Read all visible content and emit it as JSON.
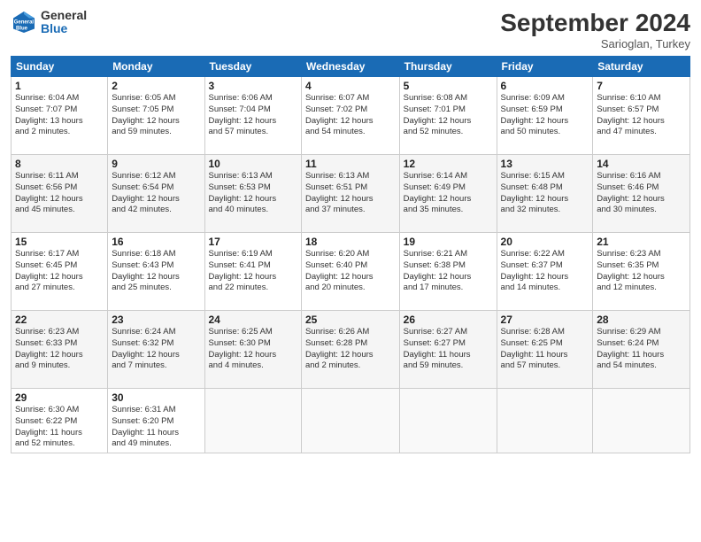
{
  "header": {
    "logo": {
      "line1": "General",
      "line2": "Blue"
    },
    "title": "September 2024",
    "subtitle": "Sarioglan, Turkey"
  },
  "weekdays": [
    "Sunday",
    "Monday",
    "Tuesday",
    "Wednesday",
    "Thursday",
    "Friday",
    "Saturday"
  ],
  "weeks": [
    [
      {
        "day": "1",
        "info": "Sunrise: 6:04 AM\nSunset: 7:07 PM\nDaylight: 13 hours\nand 2 minutes."
      },
      {
        "day": "2",
        "info": "Sunrise: 6:05 AM\nSunset: 7:05 PM\nDaylight: 12 hours\nand 59 minutes."
      },
      {
        "day": "3",
        "info": "Sunrise: 6:06 AM\nSunset: 7:04 PM\nDaylight: 12 hours\nand 57 minutes."
      },
      {
        "day": "4",
        "info": "Sunrise: 6:07 AM\nSunset: 7:02 PM\nDaylight: 12 hours\nand 54 minutes."
      },
      {
        "day": "5",
        "info": "Sunrise: 6:08 AM\nSunset: 7:01 PM\nDaylight: 12 hours\nand 52 minutes."
      },
      {
        "day": "6",
        "info": "Sunrise: 6:09 AM\nSunset: 6:59 PM\nDaylight: 12 hours\nand 50 minutes."
      },
      {
        "day": "7",
        "info": "Sunrise: 6:10 AM\nSunset: 6:57 PM\nDaylight: 12 hours\nand 47 minutes."
      }
    ],
    [
      {
        "day": "8",
        "info": "Sunrise: 6:11 AM\nSunset: 6:56 PM\nDaylight: 12 hours\nand 45 minutes."
      },
      {
        "day": "9",
        "info": "Sunrise: 6:12 AM\nSunset: 6:54 PM\nDaylight: 12 hours\nand 42 minutes."
      },
      {
        "day": "10",
        "info": "Sunrise: 6:13 AM\nSunset: 6:53 PM\nDaylight: 12 hours\nand 40 minutes."
      },
      {
        "day": "11",
        "info": "Sunrise: 6:13 AM\nSunset: 6:51 PM\nDaylight: 12 hours\nand 37 minutes."
      },
      {
        "day": "12",
        "info": "Sunrise: 6:14 AM\nSunset: 6:49 PM\nDaylight: 12 hours\nand 35 minutes."
      },
      {
        "day": "13",
        "info": "Sunrise: 6:15 AM\nSunset: 6:48 PM\nDaylight: 12 hours\nand 32 minutes."
      },
      {
        "day": "14",
        "info": "Sunrise: 6:16 AM\nSunset: 6:46 PM\nDaylight: 12 hours\nand 30 minutes."
      }
    ],
    [
      {
        "day": "15",
        "info": "Sunrise: 6:17 AM\nSunset: 6:45 PM\nDaylight: 12 hours\nand 27 minutes."
      },
      {
        "day": "16",
        "info": "Sunrise: 6:18 AM\nSunset: 6:43 PM\nDaylight: 12 hours\nand 25 minutes."
      },
      {
        "day": "17",
        "info": "Sunrise: 6:19 AM\nSunset: 6:41 PM\nDaylight: 12 hours\nand 22 minutes."
      },
      {
        "day": "18",
        "info": "Sunrise: 6:20 AM\nSunset: 6:40 PM\nDaylight: 12 hours\nand 20 minutes."
      },
      {
        "day": "19",
        "info": "Sunrise: 6:21 AM\nSunset: 6:38 PM\nDaylight: 12 hours\nand 17 minutes."
      },
      {
        "day": "20",
        "info": "Sunrise: 6:22 AM\nSunset: 6:37 PM\nDaylight: 12 hours\nand 14 minutes."
      },
      {
        "day": "21",
        "info": "Sunrise: 6:23 AM\nSunset: 6:35 PM\nDaylight: 12 hours\nand 12 minutes."
      }
    ],
    [
      {
        "day": "22",
        "info": "Sunrise: 6:23 AM\nSunset: 6:33 PM\nDaylight: 12 hours\nand 9 minutes."
      },
      {
        "day": "23",
        "info": "Sunrise: 6:24 AM\nSunset: 6:32 PM\nDaylight: 12 hours\nand 7 minutes."
      },
      {
        "day": "24",
        "info": "Sunrise: 6:25 AM\nSunset: 6:30 PM\nDaylight: 12 hours\nand 4 minutes."
      },
      {
        "day": "25",
        "info": "Sunrise: 6:26 AM\nSunset: 6:28 PM\nDaylight: 12 hours\nand 2 minutes."
      },
      {
        "day": "26",
        "info": "Sunrise: 6:27 AM\nSunset: 6:27 PM\nDaylight: 11 hours\nand 59 minutes."
      },
      {
        "day": "27",
        "info": "Sunrise: 6:28 AM\nSunset: 6:25 PM\nDaylight: 11 hours\nand 57 minutes."
      },
      {
        "day": "28",
        "info": "Sunrise: 6:29 AM\nSunset: 6:24 PM\nDaylight: 11 hours\nand 54 minutes."
      }
    ],
    [
      {
        "day": "29",
        "info": "Sunrise: 6:30 AM\nSunset: 6:22 PM\nDaylight: 11 hours\nand 52 minutes."
      },
      {
        "day": "30",
        "info": "Sunrise: 6:31 AM\nSunset: 6:20 PM\nDaylight: 11 hours\nand 49 minutes."
      },
      {
        "day": "",
        "info": ""
      },
      {
        "day": "",
        "info": ""
      },
      {
        "day": "",
        "info": ""
      },
      {
        "day": "",
        "info": ""
      },
      {
        "day": "",
        "info": ""
      }
    ]
  ]
}
